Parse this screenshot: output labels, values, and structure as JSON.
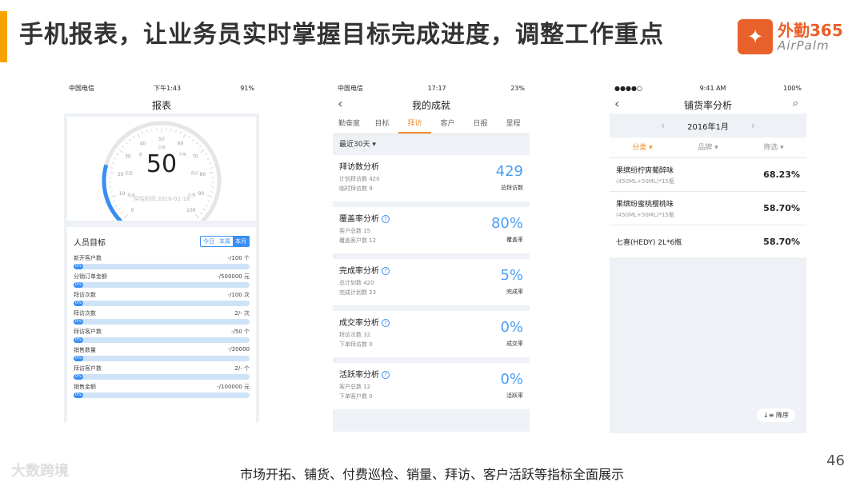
{
  "slide": {
    "title": "手机报表，让业务员实时掌握目标完成进度，调整工作重点",
    "caption": "市场开拓、铺货、付费巡检、销量、拜访、客户活跃等指标全面展示",
    "page_number": "46",
    "watermark": "大数跨境",
    "accent_color": "#f5a300"
  },
  "logo": {
    "cn": "外勤365",
    "en": "AirPalm",
    "mark": "✦",
    "color": "#e9612a"
  },
  "phone1": {
    "status": {
      "carrier": "中国电信",
      "time": "下午1:43",
      "battery": "91%"
    },
    "title": "报表",
    "gauge": {
      "value": "50",
      "time_label": "评估时间:2016-01-18",
      "level": 0.5,
      "ticks": [
        "0",
        "10",
        "20",
        "30",
        "40",
        "50",
        "60",
        "70",
        "80",
        "90",
        "100"
      ],
      "labels": [
        "极差",
        "较差",
        "差",
        "及格",
        "中等",
        "良好",
        "优秀"
      ]
    },
    "targets": {
      "title": "人员目标",
      "periods": [
        "今日",
        "本周",
        "本月"
      ],
      "active_period": "本月",
      "items": [
        {
          "label": "新开客户数",
          "value": "-/100 个",
          "pct": "0%"
        },
        {
          "label": "分销订单金额",
          "value": "-/500000 元",
          "pct": "0%"
        },
        {
          "label": "拜访次数",
          "value": "-/100 次",
          "pct": "0%"
        },
        {
          "label": "拜访次数",
          "value": "2/- 次",
          "pct": "0%"
        },
        {
          "label": "拜访客户数",
          "value": "-/50 个",
          "pct": "0%"
        },
        {
          "label": "销售数量",
          "value": "-/20000",
          "pct": "0%"
        },
        {
          "label": "拜访客户数",
          "value": "2/- 个",
          "pct": "0%"
        },
        {
          "label": "销售金额",
          "value": "-/100000 元",
          "pct": "0%"
        }
      ]
    }
  },
  "phone2": {
    "status": {
      "carrier": "中国电信",
      "time": "17:17",
      "battery": "23%"
    },
    "title": "我的成就",
    "tabs": [
      "勤奋度",
      "目标",
      "拜访",
      "客户",
      "日报",
      "里程"
    ],
    "active_tab": "拜访",
    "filter": "最近30天 ▾",
    "cards": [
      {
        "title": "拜访数分析",
        "help": false,
        "line1": "计划拜访数 420",
        "line2": "临时拜访数 9",
        "value": "429",
        "caption": "总拜访数"
      },
      {
        "title": "覆盖率分析",
        "help": true,
        "line1": "客户总数 15",
        "line2": "覆盖客户数 12",
        "value": "80%",
        "caption": "覆盖率"
      },
      {
        "title": "完成率分析",
        "help": true,
        "line1": "总计划数 420",
        "line2": "完成计划数 23",
        "value": "5%",
        "caption": "完成率"
      },
      {
        "title": "成交率分析",
        "help": true,
        "line1": "拜访次数 32",
        "line2": "下单拜访数 0",
        "value": "0%",
        "caption": "成交率"
      },
      {
        "title": "活跃率分析",
        "help": true,
        "line1": "客户总数 12",
        "line2": "下单客户数 0",
        "value": "0%",
        "caption": "活跃率"
      }
    ]
  },
  "phone3": {
    "status": {
      "time": "9:41 AM",
      "battery": "100%"
    },
    "title": "铺货率分析",
    "month": "2016年1月",
    "sort_tabs": [
      "分类 ▾",
      "品牌 ▾",
      "筛选 ▾"
    ],
    "rows": [
      {
        "name": "果缤纷柠爽葡醉味",
        "spec": "(450ML+50ML)*15瓶",
        "value": "68.23%"
      },
      {
        "name": "果缤纷蜜桃樱桃味",
        "spec": "(450ML+50ML)*15瓶",
        "value": "58.70%"
      },
      {
        "name": "七喜(HEDY) 2L*6瓶",
        "spec": "",
        "value": "58.70%"
      }
    ],
    "sort_button": "降序"
  }
}
